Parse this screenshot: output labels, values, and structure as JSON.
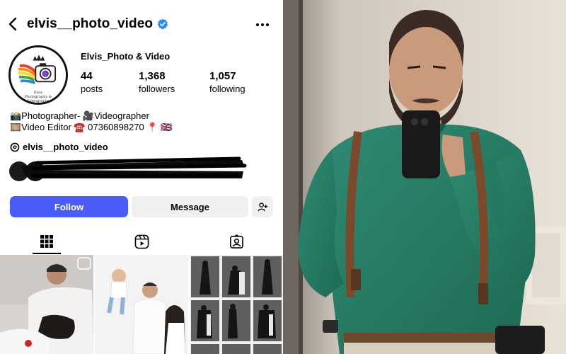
{
  "header": {
    "username": "elvis__photo_video",
    "back_icon": "chevron-left-icon",
    "verified_icon": "verified-badge-icon",
    "more_icon": "more-horizontal-icon"
  },
  "profile": {
    "display_name": "Elvis_Photo & Video",
    "avatar_logo_text": "Elvis",
    "avatar_logo_subtext": "Photography & Videography",
    "stats": [
      {
        "value": "44",
        "label": "posts"
      },
      {
        "value": "1,368",
        "label": "followers"
      },
      {
        "value": "1,057",
        "label": "following"
      }
    ],
    "bio_lines": [
      "📸Photographer- 🎥Videographer",
      "🎞️Video Editor ☎️ 07360898270 📍 🇬🇧"
    ],
    "threads_handle": "elvis__photo_video",
    "threads_icon": "threads-icon"
  },
  "actions": {
    "follow_label": "Follow",
    "message_label": "Message",
    "add_person_icon": "add-person-icon",
    "follow_color": "#4a5cf7"
  },
  "tabs": [
    {
      "icon": "grid-icon",
      "active": true
    },
    {
      "icon": "reels-icon",
      "active": false
    },
    {
      "icon": "tagged-icon",
      "active": false
    }
  ],
  "posts": [
    {
      "icon": "reel-badge-icon"
    },
    {},
    {}
  ]
}
